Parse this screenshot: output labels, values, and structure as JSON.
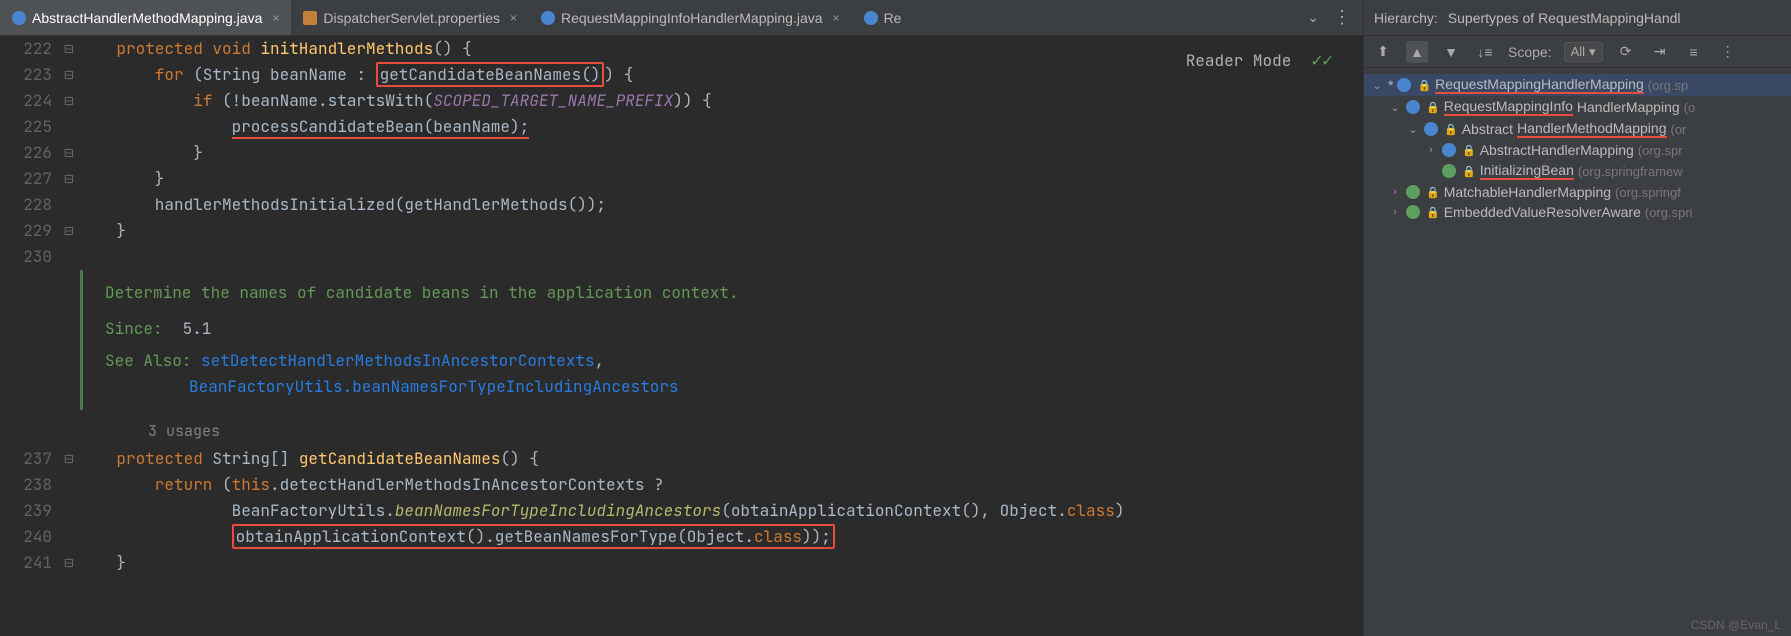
{
  "tabs": {
    "t0": "AbstractHandlerMethodMapping.java",
    "t1": "DispatcherServlet.properties",
    "t2": "RequestMappingInfoHandlerMapping.java",
    "t3": "Re"
  },
  "reader": {
    "label": "Reader Mode"
  },
  "lines": {
    "l222": "222",
    "l223": "223",
    "l224": "224",
    "l225": "225",
    "l226": "226",
    "l227": "227",
    "l228": "228",
    "l229": "229",
    "l230": "230",
    "l237": "237",
    "l238": "238",
    "l239": "239",
    "l240": "240",
    "l241": "241"
  },
  "code": {
    "c222a": "    protected void ",
    "c222b": "initHandlerMethods",
    "c222c": "() {",
    "c223a": "        for ",
    "c223b": "(String beanName : ",
    "c223c": "getCandidateBeanNames()",
    "c223d": ") {",
    "c224a": "            if ",
    "c224b": "(!beanName.startsWith(",
    "c224c": "SCOPED_TARGET_NAME_PREFIX",
    "c224d": ")) {",
    "c225a": "                ",
    "c225b": "processCandidateBean(beanName);",
    "c226": "            }",
    "c227": "        }",
    "c228a": "        handlerMethodsInitialized(",
    "c228b": "getHandlerMethods()",
    "c228c": ");",
    "c229": "    }",
    "c230": "",
    "doc1": "Determine the names of candidate beans in the application context.",
    "doc_since_l": "Since:",
    "doc_since_v": "5.1",
    "doc_see_l": "See Also:",
    "doc_see1": "setDetectHandlerMethodsInAncestorContexts",
    "doc_see2": "BeanFactoryUtils.beanNamesForTypeIncludingAncestors",
    "usages": "3 usages",
    "c237a": "    protected ",
    "c237b": "String[] ",
    "c237c": "getCandidateBeanNames",
    "c237d": "() {",
    "c238a": "        return ",
    "c238b": "(",
    "c238c": "this",
    "c238d": ".detectHandlerMethodsInAncestorContexts ?",
    "c239a": "                BeanFactoryUtils.",
    "c239b": "beanNamesForTypeIncludingAncestors",
    "c239c": "(obtainApplicationContext(), Object.",
    "c239d": "class",
    "c239e": ")",
    "c240a": "                ",
    "c240b": "obtainApplicationContext().getBeanNamesForType(Object.",
    "c240c": "class",
    "c240d": "));",
    "c241": "    }"
  },
  "hierarchy": {
    "title_l": "Hierarchy:",
    "title_v": "Supertypes of RequestMappingHandl",
    "scope_l": "Scope:",
    "scope_v": "All",
    "n0": "RequestMappingHandlerMapping",
    "p0": "(org.sp",
    "n1": "RequestMappingInfo",
    "n1b": "HandlerMapping",
    "p1": "(o",
    "n2": "Abstract",
    "n2b": "HandlerMethodMapping",
    "p2": "(or",
    "n3": "AbstractHandlerMapping",
    "p3": "(org.spr",
    "n4": "InitializingBean",
    "p4": "(org.springframew",
    "n5": "MatchableHandlerMapping",
    "p5": "(org.springf",
    "n6": "EmbeddedValueResolverAware",
    "p6": "(org.spri"
  },
  "watermark": "CSDN @Evan_L"
}
